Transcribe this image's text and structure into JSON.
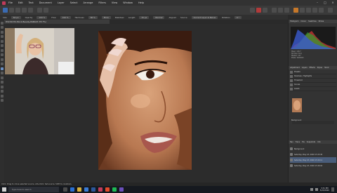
{
  "menubar": {
    "items": [
      "File",
      "Edit",
      "Text",
      "Document",
      "Layer",
      "Select",
      "Arrange",
      "Filters",
      "View",
      "Window",
      "Help"
    ]
  },
  "context_bar": {
    "items": [
      {
        "label": "Size",
        "value": "64 px"
      },
      {
        "label": "Opacity",
        "value": "100 %"
      },
      {
        "label": "Flow",
        "value": "100 %"
      },
      {
        "label": "Hardness",
        "value": "80 %"
      },
      {
        "label": "More",
        "value": ""
      },
      {
        "label": "Stabiliser",
        "value": ""
      },
      {
        "label": "Length",
        "value": "30 px"
      },
      {
        "label": "Normal",
        "value": ""
      },
      {
        "label": "Aligned",
        "value": ""
      },
      {
        "label": "Source",
        "value": "Current Layer & Below"
      },
      {
        "label": "Rotation",
        "value": "0 °"
      }
    ]
  },
  "document_tab": "DSC01234-Stock-Beauty-RGBA/8 (35.7%)",
  "right_panel": {
    "histogram_tabs": [
      "Histogram",
      "Colour",
      "Swatches",
      "Stroke"
    ],
    "histogram_info": [
      "Mean: 118.7",
      "Std Dev: 64.2",
      "Median: 117",
      "Pixels: 2400000"
    ],
    "adjust_tabs": [
      "Adjustment",
      "Layers",
      "Effects",
      "Styles",
      "Stock"
    ],
    "adjustments": [
      "Presets",
      "Shadows / Highlights",
      "Threshold",
      "Curves",
      "Levels"
    ],
    "layer_name": "Background",
    "history_tabs": [
      "Nav",
      "Trans",
      "His",
      "Snapshots",
      "Info"
    ],
    "history": [
      {
        "label": "Background",
        "selected": false
      },
      {
        "label": "Saturday, May 23, 2020 17:23:45",
        "selected": false
      },
      {
        "label": "Saturday, May 23, 2020 17:24:11",
        "selected": true
      },
      {
        "label": "Saturday, May 23, 2020 17:26:02",
        "selected": false
      }
    ]
  },
  "status_text": "Click: Drag to clone selected source. Alt+Click: Set source. Shift to constrain.",
  "taskbar": {
    "search_placeholder": "Type here to search",
    "time": "3:31 PM",
    "date": "5/23/2020"
  }
}
